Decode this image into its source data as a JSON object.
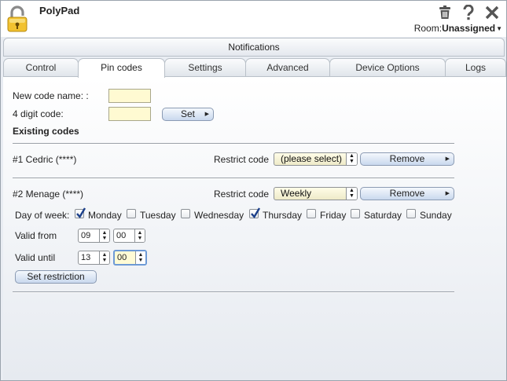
{
  "app": {
    "title": "PolyPad"
  },
  "header": {
    "room_label": "Room:",
    "room_value": "Unassigned"
  },
  "notifications": {
    "label": "Notifications"
  },
  "tabs": [
    {
      "label": "Control"
    },
    {
      "label": "Pin codes",
      "active": true
    },
    {
      "label": "Settings"
    },
    {
      "label": "Advanced"
    },
    {
      "label": "Device Options"
    },
    {
      "label": "Logs"
    }
  ],
  "form": {
    "new_code_label": "New code name: :",
    "digit_label": "4 digit code:",
    "set_label": "Set",
    "existing_heading": "Existing codes"
  },
  "codes": [
    {
      "name": "#1 Cedric (****)",
      "restrict_label": "Restrict code",
      "restrict_value": "(please select)",
      "remove_label": "Remove"
    },
    {
      "name": "#2 Menage (****)",
      "restrict_label": "Restrict code",
      "restrict_value": "Weekly",
      "remove_label": "Remove"
    }
  ],
  "restriction": {
    "day_of_week_label": "Day of week:",
    "days": [
      {
        "label": "Monday",
        "checked": true
      },
      {
        "label": "Tuesday",
        "checked": false
      },
      {
        "label": "Wednesday",
        "checked": false
      },
      {
        "label": "Thursday",
        "checked": true
      },
      {
        "label": "Friday",
        "checked": false
      },
      {
        "label": "Saturday",
        "checked": false
      },
      {
        "label": "Sunday",
        "checked": false
      }
    ],
    "valid_from_label": "Valid from",
    "valid_from_hour": "09",
    "valid_from_min": "00",
    "valid_until_label": "Valid until",
    "valid_until_hour": "13",
    "valid_until_min": "00",
    "set_restriction_label": "Set restriction"
  },
  "icons": {
    "logo": "padlock-icon",
    "trash": "trash-icon",
    "help": "help-icon",
    "close": "close-icon"
  },
  "colors": {
    "input_bg": "#fffad2",
    "button_bg": "#c9d8ee",
    "select_bg": "#fffde8"
  }
}
